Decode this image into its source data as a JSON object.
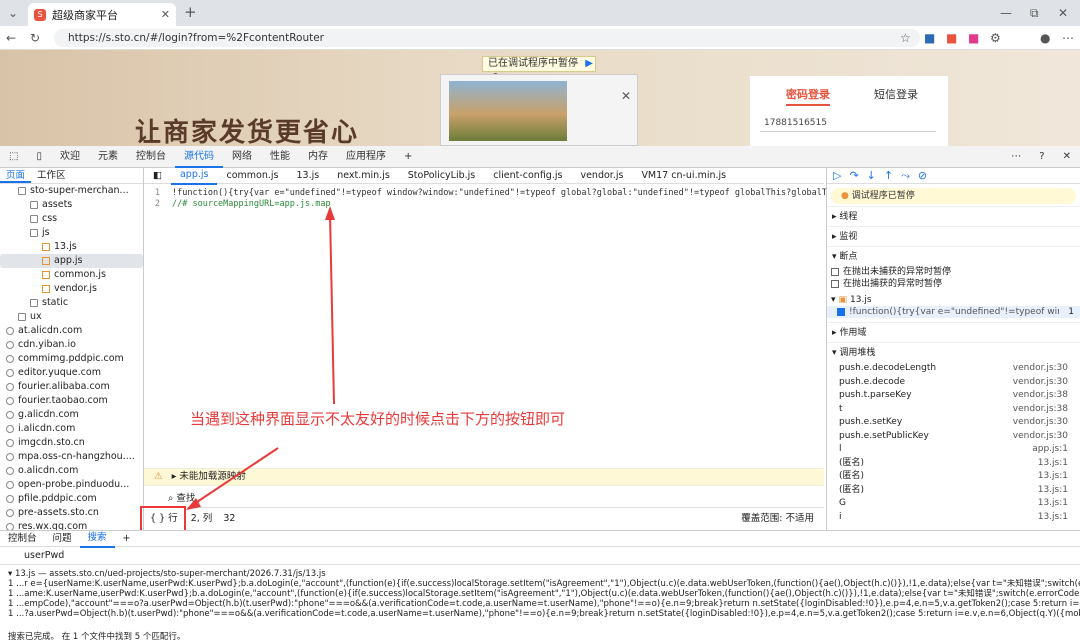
{
  "browser": {
    "tab_title": "超级商家平台",
    "url": "https://s.sto.cn/#/login?from=%2FcontentRouter"
  },
  "page": {
    "paused_banner": "已在调试程序中暂停",
    "slogan": "让商家发货更省心",
    "login_tab_password": "密码登录",
    "login_tab_sms": "短信登录",
    "phone_value": "17881516515"
  },
  "devtools": {
    "toolbar": [
      "欢迎",
      "元素",
      "控制台",
      "源代码",
      "网络",
      "性能",
      "内存",
      "应用程序"
    ],
    "nav_tabs": [
      "页面",
      "工作区"
    ],
    "tree": [
      {
        "label": "sto-super-merchan...",
        "type": "folder",
        "indent": 1
      },
      {
        "label": "assets",
        "type": "folder",
        "indent": 2
      },
      {
        "label": "css",
        "type": "folder",
        "indent": 2
      },
      {
        "label": "js",
        "type": "folder",
        "indent": 2
      },
      {
        "label": "13.js",
        "type": "file",
        "indent": 3
      },
      {
        "label": "app.js",
        "type": "file",
        "indent": 3,
        "selected": true
      },
      {
        "label": "common.js",
        "type": "file",
        "indent": 3
      },
      {
        "label": "vendor.js",
        "type": "file",
        "indent": 3
      },
      {
        "label": "static",
        "type": "folder",
        "indent": 2
      },
      {
        "label": "ux",
        "type": "folder",
        "indent": 1
      },
      {
        "label": "at.alicdn.com",
        "type": "cloud",
        "indent": 0
      },
      {
        "label": "cdn.yiban.io",
        "type": "cloud",
        "indent": 0
      },
      {
        "label": "commimg.pddpic.com",
        "type": "cloud",
        "indent": 0
      },
      {
        "label": "editor.yuque.com",
        "type": "cloud",
        "indent": 0
      },
      {
        "label": "fourier.alibaba.com",
        "type": "cloud",
        "indent": 0
      },
      {
        "label": "fourier.taobao.com",
        "type": "cloud",
        "indent": 0
      },
      {
        "label": "g.alicdn.com",
        "type": "cloud",
        "indent": 0
      },
      {
        "label": "i.alicdn.com",
        "type": "cloud",
        "indent": 0
      },
      {
        "label": "imgcdn.sto.cn",
        "type": "cloud",
        "indent": 0
      },
      {
        "label": "mpa.oss-cn-hangzhou....",
        "type": "cloud",
        "indent": 0
      },
      {
        "label": "o.alicdn.com",
        "type": "cloud",
        "indent": 0
      },
      {
        "label": "open-probe.pinduodu...",
        "type": "cloud",
        "indent": 0
      },
      {
        "label": "pfile.pddpic.com",
        "type": "cloud",
        "indent": 0
      },
      {
        "label": "pre-assets.sto.cn",
        "type": "cloud",
        "indent": 0
      },
      {
        "label": "res.wx.qq.com",
        "type": "cloud",
        "indent": 0
      }
    ],
    "editor_tabs": [
      "app.js",
      "common.js",
      "13.js",
      "next.min.js",
      "StoPolicyLib.js",
      "client-config.js",
      "vendor.js",
      "VM17 cn-ui.min.js"
    ],
    "code_line1": "!function(){try{var e=\"undefined\"!=typeof window?window:\"undefined\"!=typeof global?global:\"undefined\"!=typeof globalThis?globalThis:\"undefined\"!=typeof",
    "code_line2": "//# sourceMappingURL=app.js.map",
    "annotation": "当遇到这种界面显示不太友好的时候点击下方的按钮即可",
    "warning": "未能加载源映射",
    "find_label": "查找",
    "status": {
      "pretty": "{ }",
      "line_label": "行",
      "col_label": "2, 列",
      "col": "32",
      "coverage": "覆盖范围: 不适用"
    },
    "debugger": {
      "paused_msg": "调试程序已暂停",
      "sections": [
        "线程",
        "监视",
        "断点"
      ],
      "bp_uncaught": "在抛出未捕获的异常时暂停",
      "bp_caught": "在抛出捕获的异常时暂停",
      "bp_file": "13.js",
      "bp_code": "!function(){try{var e=\"undefined\"!=typeof windo...",
      "bp_line": "1",
      "scope": "作用域",
      "callstack": "调用堆栈",
      "frames": [
        {
          "fn": "push.e.decodeLength",
          "loc": "vendor.js:30"
        },
        {
          "fn": "push.e.decode",
          "loc": "vendor.js:30"
        },
        {
          "fn": "push.t.parseKey",
          "loc": "vendor.js:38"
        },
        {
          "fn": "t",
          "loc": "vendor.js:38"
        },
        {
          "fn": "push.e.setKey",
          "loc": "vendor.js:30"
        },
        {
          "fn": "push.e.setPublicKey",
          "loc": "vendor.js:30"
        },
        {
          "fn": "l",
          "loc": "app.js:1"
        },
        {
          "fn": "(匿名)",
          "loc": "13.js:1"
        },
        {
          "fn": "(匿名)",
          "loc": "13.js:1"
        },
        {
          "fn": "(匿名)",
          "loc": "13.js:1"
        },
        {
          "fn": "G",
          "loc": "13.js:1"
        },
        {
          "fn": "i",
          "loc": "13.js:1"
        }
      ]
    },
    "drawer": {
      "tabs": [
        "控制台",
        "问题",
        "搜索"
      ],
      "query": "userPwd",
      "file_header": "13.js — assets.sto.cn/ued-projects/sto-super-merchant/2026.7.31/js/13.js",
      "results": [
        "...r e={userName:K.userName,userPwd:K.userPwd};b.a.doLogin(e,\"account\",(function(e){if(e.success)localStorage.setItem(\"isAgreement\",\"1\"),Object(u.c)(e.data.webUserToken,(function(){ae(),Object(h.c)()}),!1,e.data);else{var t=\"未知错误\";switch(e.errorCode){case\"101\":t=\"您还没有注册，请...",
        "...ame:K.userName,userPwd:K.userPwd};b.a.doLogin(e,\"account\",(function(e){if(e.success)localStorage.setItem(\"isAgreement\",\"1\"),Object(u.c)(e.data.webUserToken,(function(){ae(),Object(h.c)()}),!1,e.data);else{var t=\"未知错误\";switch(e.errorCode){case\"101\":t=\"您还没有注册，请先注册\";brea...",
        "...empCode),\"account\"===o?a.userPwd=Object(h.b)(t.userPwd):\"phone\"===o&&(a.verificationCode=t.code,a.userName=t.userName),\"phone\"!==o){e.n=9;break}return n.setState({loginDisabled:!0}),e.p=4,e.n=5,v.a.getToken2();case 5:return i=e.v,e.n=6,Object(q.Y)({mobile:t.userName,acc...",
        "...?a.userPwd=Object(h.b)(t.userPwd):\"phone\"===o&&(a.verificationCode=t.code,a.userName=t.userName),\"phone\"!==o){e.n=9;break}return n.setState({loginDisabled:!0}),e.p=4,e.n=5,v.a.getToken2();case 5:return i=e.v,e.n=6,Object(q.Y)({mobile:t.userName,accessToken:i.data});case 6:if(c..."
      ],
      "status": "搜索已完成。 在 1 个文件中找到 5 个匹配行。"
    }
  }
}
